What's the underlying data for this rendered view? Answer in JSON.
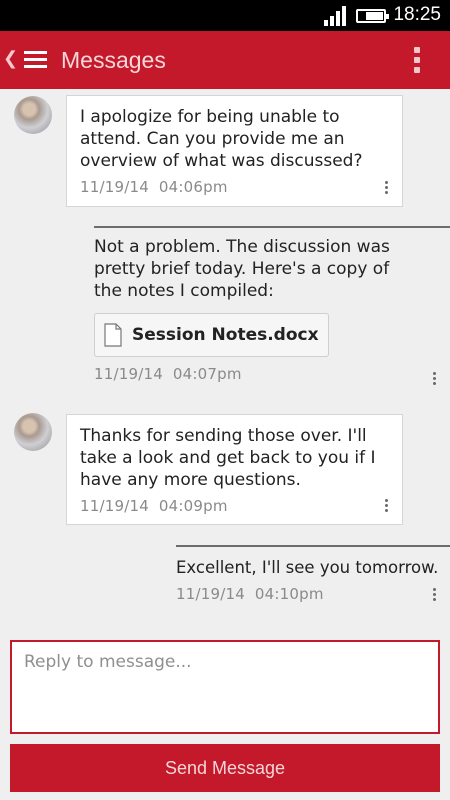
{
  "status_bar": {
    "time": "18:25",
    "icons": [
      "signal-icon",
      "battery-icon"
    ]
  },
  "header": {
    "title": "Messages",
    "icons": [
      "back-icon",
      "hamburger-menu-icon",
      "overflow-menu-icon"
    ]
  },
  "messages": [
    {
      "direction": "incoming",
      "text": "I apologize for being unable to attend. Can you provide me an overview of what was discussed?",
      "date": "11/19/14",
      "time": "04:06pm"
    },
    {
      "direction": "outgoing",
      "text": "Not a problem. The discussion was pretty brief today. Here's a copy of the notes I compiled:",
      "attachment": "Session Notes.docx",
      "date": "11/19/14",
      "time": "04:07pm"
    },
    {
      "direction": "incoming",
      "text": "Thanks for sending those over. I'll take a look and get back to you if I have any more questions.",
      "date": "11/19/14",
      "time": "04:09pm"
    },
    {
      "direction": "outgoing",
      "text": "Excellent, I'll see you tomorrow.",
      "date": "11/19/14",
      "time": "04:10pm"
    }
  ],
  "composer": {
    "placeholder": "Reply to message...",
    "value": "",
    "send_label": "Send Message"
  },
  "colors": {
    "accent": "#c4192a",
    "background": "#efefef",
    "bubble": "#ffffff",
    "meta_text": "#8a8a8a"
  }
}
